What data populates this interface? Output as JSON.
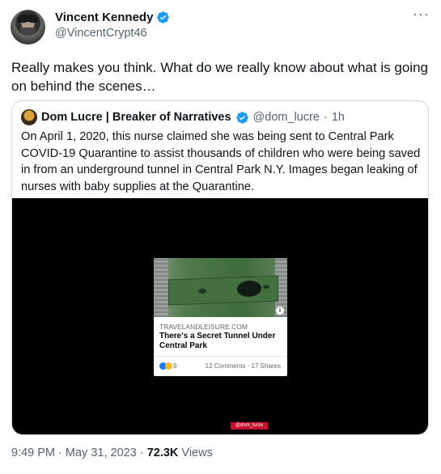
{
  "author": {
    "name": "Vincent Kennedy",
    "handle": "@VincentCrypt46",
    "verified_icon": "verified-badge-icon"
  },
  "menu_icon": "more-icon",
  "more_glyph": "···",
  "tweet": {
    "text": "Really makes you think. What do we really know about what is going on behind the scenes…"
  },
  "quoted": {
    "name": "Dom Lucre | Breaker of Narratives",
    "handle": "@dom_lucre",
    "dot": "·",
    "time": "1h",
    "text": "On April 1, 2020, this nurse claimed she was being sent to Central Park COVID-19 Quarantine to assist thousands of children who were being saved in from an underground tunnel in Central Park N.Y. Images began leaking of nurses with baby supplies at the Quarantine.",
    "video": {
      "card": {
        "domain": "TRAVELANDLEISURE.COM",
        "title": "There's a Secret Tunnel Under Central Park",
        "reactions": "9",
        "stats": "12 Comments · 17 Shares",
        "info_glyph": "i"
      },
      "watermark": "@dom_lucre"
    }
  },
  "meta": {
    "time": "9:49 PM",
    "sep1": "·",
    "date": "May 31, 2023",
    "sep2": "·",
    "views": "72.3K",
    "views_label": "Views"
  },
  "colors": {
    "verified": "#1d9bf0",
    "secondary_text": "#536471",
    "watermark_bg": "#c8102e"
  }
}
